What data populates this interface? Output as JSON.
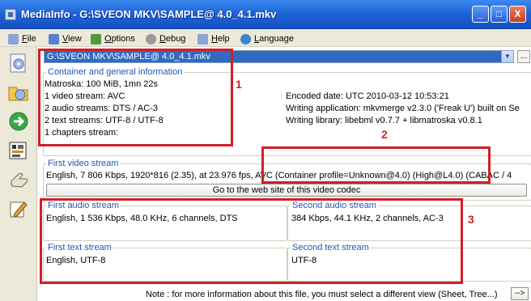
{
  "window": {
    "title": "MediaInfo - G:\\SVEON MKV\\SAMPLE@ 4.0_4.1.mkv",
    "controls": {
      "minimize": "_",
      "maximize": "□",
      "close": "X"
    }
  },
  "menu": [
    {
      "label": "File",
      "icon": "folder-icon",
      "color": "#6a86c8"
    },
    {
      "label": "View",
      "icon": "view-icon",
      "color": "#5a7fd0"
    },
    {
      "label": "Options",
      "icon": "options-icon",
      "color": "#4f9a3b"
    },
    {
      "label": "Debug",
      "icon": "debug-icon",
      "color": "#7a7a7a"
    },
    {
      "label": "Help",
      "icon": "help-icon",
      "color": "#6a86c8"
    },
    {
      "label": "Language",
      "icon": "language-icon",
      "color": "#3d86c6"
    }
  ],
  "toolbar": [
    {
      "name": "open-file-icon"
    },
    {
      "name": "open-folder-icon"
    },
    {
      "name": "next-arrow-icon"
    },
    {
      "name": "export-icon"
    },
    {
      "name": "hand-icon"
    },
    {
      "name": "edit-icon"
    }
  ],
  "file_select": {
    "value": "G:\\SVEON MKV\\SAMPLE@ 4.0_4.1.mkv",
    "more": "..."
  },
  "general": {
    "title": "Container and general information",
    "lines": [
      "Matroska: 100 MiB, 1mn 22s",
      "1 video stream: AVC",
      "2 audio streams: DTS / AC-3",
      "2 text streams: UTF-8 / UTF-8",
      "1 chapters stream:"
    ],
    "right": [
      "Encoded date: UTC 2010-03-12 10:53:21",
      "Writing application: mkvmerge v2.3.0 ('Freak U') built on Se",
      "Writing library: libebml v0.7.7 + libmatroska v0.8.1"
    ]
  },
  "video": {
    "title": "First video stream",
    "line": "English, 7 806 Kbps, 1920*816 (2.35), at 23.976 fps, AVC (Container profile=Unknown@4.0) (High@L4.0) (CABAC / 4",
    "codec_button": "Go to the web site of this video codec"
  },
  "audio1": {
    "title": "First audio stream",
    "line": "English, 1 536 Kbps, 48.0 KHz, 6 channels, DTS"
  },
  "audio2": {
    "title": "Second audio stream",
    "line": "384 Kbps, 44.1 KHz, 2 channels, AC-3"
  },
  "text1": {
    "title": "First text stream",
    "line": "English, UTF-8"
  },
  "text2": {
    "title": "Second text stream",
    "line": "UTF-8"
  },
  "note": {
    "text": "Note : for more information about this file, you must select a different view (Sheet, Tree...)",
    "button": "-->"
  },
  "annotations": {
    "one": "1",
    "two": "2",
    "three": "3",
    "color": "#d21f26"
  }
}
